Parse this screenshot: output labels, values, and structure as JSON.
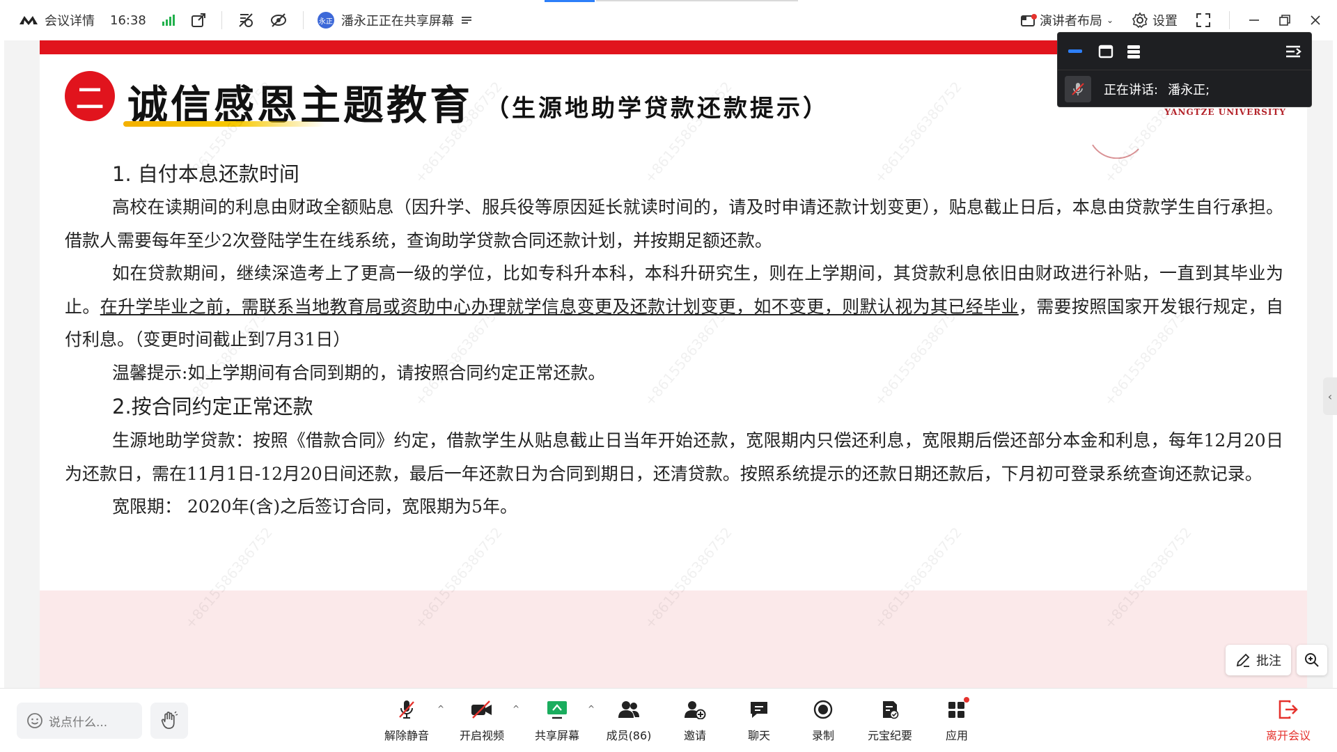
{
  "topbar": {
    "meeting_details": "会议详情",
    "time": "16:38",
    "sharing_avatar": "永正",
    "sharing_status": "潘永正正在共享屏幕",
    "presenter_layout": "演讲者布局",
    "settings": "设置"
  },
  "slide": {
    "number": "二",
    "title": "诚信感恩主题教育",
    "subtitle": "（生源地助学贷款还款提示）",
    "university": "YANGTZE UNIVERSITY",
    "section1_heading": "1. 自付本息还款时间",
    "section1_p1": "高校在读期间的利息由财政全额贴息（因升学、服兵役等原因延长就读时间的，请及时申请还款计划变更），贴息截止日后，本息由贷款学生自行承担。借款人需要每年至少2次登陆学生在线系统，查询助学贷款合同还款计划，并按期足额还款。",
    "section1_p2_a": "如在贷款期间，继续深造考上了更高一级的学位，比如专科升本科，本科升研究生，则在上学期间，其贷款利息依旧由财政进行补贴，一直到其毕业为止。",
    "section1_p2_underlined": "在升学毕业之前，需联系当地教育局或资助中心办理就学信息变更及还款计划变更，如不变更，则默认视为其已经毕业",
    "section1_p2_b": "，需要按照国家开发银行规定，自付利息。（变更时间截止到7月31日）",
    "section1_tip": "温馨提示:如上学期间有合同到期的，请按照合同约定正常还款。",
    "section2_heading": "2.按合同约定正常还款",
    "section2_p1": "生源地助学贷款：按照《借款合同》约定，借款学生从贴息截止日当年开始还款，宽限期内只偿还利息，宽限期后偿还部分本金和利息，每年12月20日为还款日，需在11月1日-12月20日间还款，最后一年还款日为合同到期日，还清贷款。按照系统提示的还款日期还款后，下月初可登录系统查询还款记录。",
    "section2_p2": "宽限期： 2020年(含)之后签订合同，宽限期为5年。",
    "watermark": "+8615586386752"
  },
  "speaker_popup": {
    "label": "正在讲话:",
    "name": "潘永正;"
  },
  "annotate_label": "批注",
  "bottombar": {
    "chat_placeholder": "说点什么...",
    "tools": {
      "unmute": "解除静音",
      "start_video": "开启视频",
      "share_screen": "共享屏幕",
      "members": "成员(86)",
      "invite": "邀请",
      "chat": "聊天",
      "record": "录制",
      "summary": "元宝纪要",
      "apps": "应用"
    },
    "leave": "离开会议"
  },
  "colors": {
    "accent_red": "#e1141d",
    "brand_blue": "#2d7ff9",
    "signal_green": "#22b14c",
    "share_green": "#1aad5e"
  }
}
